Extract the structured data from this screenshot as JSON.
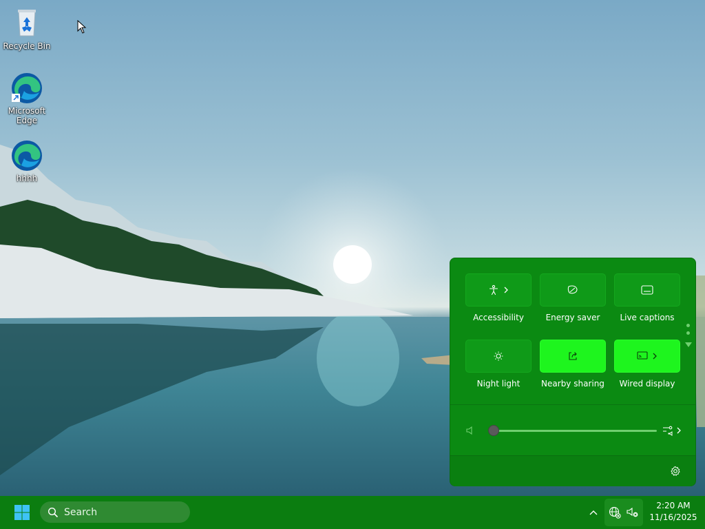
{
  "desktop": {
    "icons": [
      {
        "label": "Recycle Bin",
        "icon": "recycle-bin-icon"
      },
      {
        "label": "Microsoft Edge",
        "icon": "edge-icon"
      },
      {
        "label": "hhhh",
        "icon": "edge-icon"
      }
    ]
  },
  "quick_settings": {
    "tiles": [
      {
        "label": "Accessibility",
        "icon": "accessibility-icon",
        "has_chevron": true,
        "active": false
      },
      {
        "label": "Energy saver",
        "icon": "energy-saver-icon",
        "has_chevron": false,
        "active": false
      },
      {
        "label": "Live captions",
        "icon": "live-captions-icon",
        "has_chevron": false,
        "active": false
      },
      {
        "label": "Night light",
        "icon": "night-light-icon",
        "has_chevron": false,
        "active": false
      },
      {
        "label": "Nearby sharing",
        "icon": "nearby-sharing-icon",
        "has_chevron": false,
        "active": true
      },
      {
        "label": "Wired display",
        "icon": "wired-display-icon",
        "has_chevron": true,
        "active": true
      }
    ],
    "volume": {
      "level": 0,
      "muted": true
    },
    "footer_icon": "settings-gear-icon"
  },
  "taskbar": {
    "search_label": "Search",
    "clock": {
      "time": "2:20 AM",
      "date": "11/16/2025"
    },
    "tray": [
      "show-hidden-icons-chevron",
      "network-globe-icon",
      "volume-muted-icon"
    ]
  },
  "colors": {
    "panel": "#0b8a12",
    "tile": "#0f9a18",
    "tile_active": "#1ef51e",
    "taskbar": "#0b7d10"
  }
}
